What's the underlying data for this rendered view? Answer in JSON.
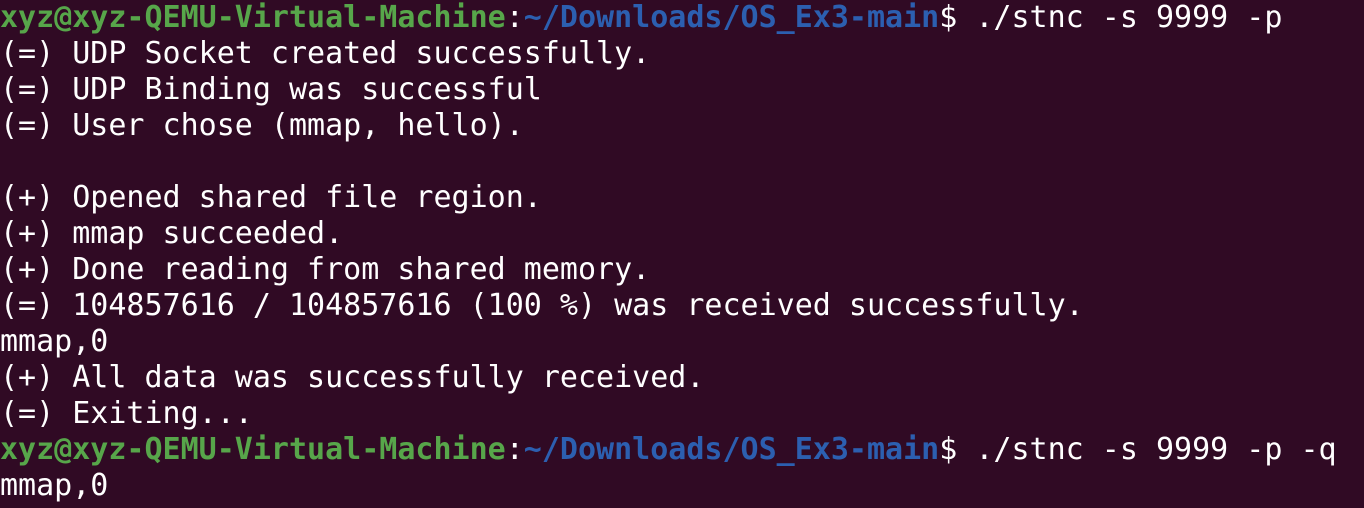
{
  "terminal": {
    "background": "#300a24",
    "prompt_user_color": "#57a64a",
    "prompt_path_color": "#2c5fb0",
    "text_color": "#ffffff",
    "lines": [
      {
        "type": "prompt",
        "user": "xyz@xyz-QEMU-Virtual-Machine",
        "sep": ":",
        "path": "~/Downloads/OS_Ex3-main",
        "dollar": "$",
        "command": " ./stnc -s 9999 -p"
      },
      {
        "type": "output",
        "text": "(=) UDP Socket created successfully."
      },
      {
        "type": "output",
        "text": "(=) UDP Binding was successful"
      },
      {
        "type": "output",
        "text": "(=) User chose (mmap, hello)."
      },
      {
        "type": "output",
        "text": ""
      },
      {
        "type": "output",
        "text": "(+) Opened shared file region."
      },
      {
        "type": "output",
        "text": "(+) mmap succeeded."
      },
      {
        "type": "output",
        "text": "(+) Done reading from shared memory."
      },
      {
        "type": "output",
        "text": "(=) 104857616 / 104857616 (100 %) was received successfully."
      },
      {
        "type": "output",
        "text": "mmap,0"
      },
      {
        "type": "output",
        "text": "(+) All data was successfully received."
      },
      {
        "type": "output",
        "text": "(=) Exiting..."
      },
      {
        "type": "prompt",
        "user": "xyz@xyz-QEMU-Virtual-Machine",
        "sep": ":",
        "path": "~/Downloads/OS_Ex3-main",
        "dollar": "$",
        "command": " ./stnc -s 9999 -p -q"
      },
      {
        "type": "output",
        "text": "mmap,0"
      }
    ]
  }
}
